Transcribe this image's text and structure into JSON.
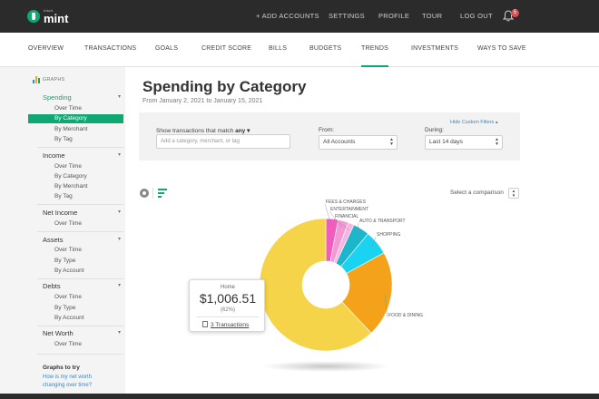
{
  "brand": {
    "small": "intuit",
    "name": "mint"
  },
  "topnav": {
    "add_accounts": "+ ADD ACCOUNTS",
    "settings": "SETTINGS",
    "profile": "PROFILE",
    "tour": "TOUR",
    "logout": "LOG OUT",
    "notifications": "5"
  },
  "mainnav": [
    {
      "label": "OVERVIEW"
    },
    {
      "label": "TRANSACTIONS"
    },
    {
      "label": "GOALS"
    },
    {
      "label": "CREDIT SCORE"
    },
    {
      "label": "BILLS"
    },
    {
      "label": "BUDGETS"
    },
    {
      "label": "TRENDS",
      "active": true
    },
    {
      "label": "INVESTMENTS"
    },
    {
      "label": "WAYS TO SAVE"
    }
  ],
  "sidebar": {
    "title": "GRAPHS",
    "groups": [
      {
        "label": "Spending",
        "items": [
          "Over Time",
          "By Category",
          "By Merchant",
          "By Tag"
        ],
        "active_item": "By Category"
      },
      {
        "label": "Income",
        "items": [
          "Over Time",
          "By Category",
          "By Merchant",
          "By Tag"
        ]
      },
      {
        "label": "Net Income",
        "items": [
          "Over Time"
        ]
      },
      {
        "label": "Assets",
        "items": [
          "Over Time",
          "By Type",
          "By Account"
        ]
      },
      {
        "label": "Debts",
        "items": [
          "Over Time",
          "By Type",
          "By Account"
        ]
      },
      {
        "label": "Net Worth",
        "items": [
          "Over Time"
        ]
      }
    ],
    "try": {
      "title": "Graphs to try",
      "link": "How is my net worth changing over time?"
    }
  },
  "content": {
    "title": "Spending by Category",
    "subtitle": "From January 2, 2021 to January 15, 2021",
    "filters": {
      "match_label": "Show transactions that match",
      "match_value": "any",
      "search_placeholder": "Add a category, merchant, or tag",
      "from_label": "From:",
      "from_value": "All Accounts",
      "during_label": "During:",
      "during_value": "Last 14 days",
      "hide_filters": "Hide Custom Filters"
    },
    "compare_label": "Select a comparison"
  },
  "tooltip": {
    "name": "Home",
    "value": "$1,006.51",
    "pct": "(62%)",
    "link": "3 Transactions"
  },
  "chart_data": {
    "type": "pie",
    "slices": [
      {
        "label": "Home",
        "percent": 62,
        "color": "#f5d44a"
      },
      {
        "label": "FOOD & DINING",
        "percent": 21,
        "color": "#f5a21b"
      },
      {
        "label": "SHOPPING",
        "percent": 6,
        "color": "#1ad3f0"
      },
      {
        "label": "AUTO & TRANSPORT",
        "percent": 4,
        "color": "#1bb6c9"
      },
      {
        "label": "FINANCIAL",
        "percent": 1.5,
        "color": "#f7b6e1"
      },
      {
        "label": "ENTERTAINMENT",
        "percent": 2.5,
        "color": "#f39ad5"
      },
      {
        "label": "FEES & CHARGES",
        "percent": 3,
        "color": "#f05dbf"
      }
    ]
  }
}
